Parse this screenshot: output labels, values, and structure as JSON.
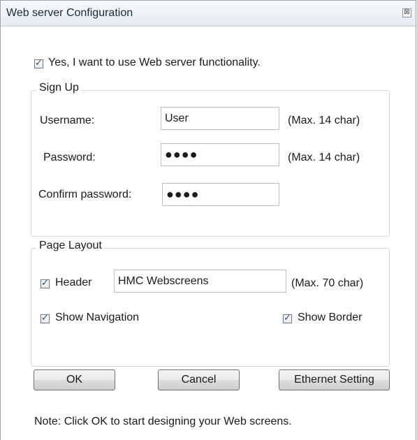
{
  "window": {
    "title": "Web server Configuration",
    "close_glyph": "⊠"
  },
  "enable": {
    "checked": true,
    "label": "Yes, I want to use Web server functionality."
  },
  "signup": {
    "title": "Sign Up",
    "username_label": "Username:",
    "username_value": "User",
    "username_hint": "(Max. 14 char)",
    "password_label": "Password:",
    "password_value": "●●●●",
    "password_hint": "(Max. 14 char)",
    "confirm_label": "Confirm password:",
    "confirm_value": "●●●●"
  },
  "layout": {
    "title": "Page Layout",
    "header_checked": true,
    "header_label": "Header",
    "header_value": "HMC Webscreens",
    "header_hint": "(Max. 70 char)",
    "nav_checked": true,
    "nav_label": "Show Navigation",
    "border_checked": true,
    "border_label": "Show Border"
  },
  "buttons": {
    "ok": "OK",
    "cancel": "Cancel",
    "ethernet": "Ethernet Setting"
  },
  "note": "Note:  Click OK to start designing your Web screens."
}
